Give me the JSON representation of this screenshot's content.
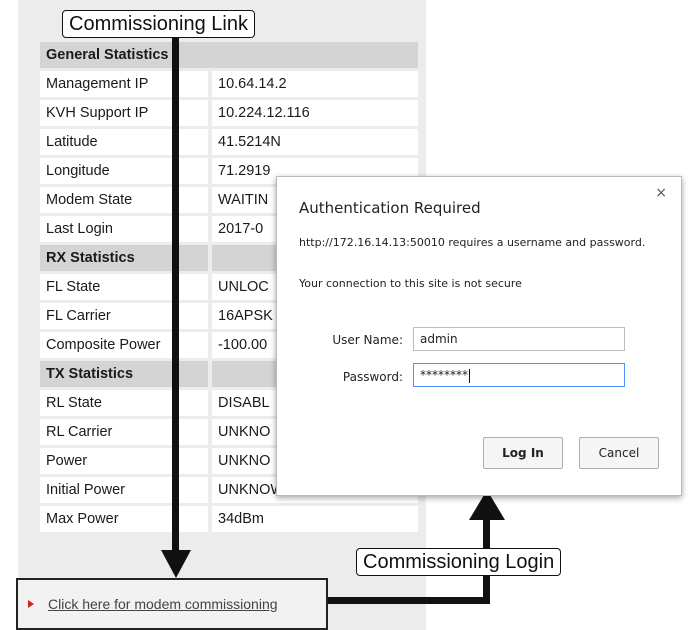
{
  "callouts": {
    "top": "Commissioning Link",
    "bottom": "Commissioning Login"
  },
  "stats": {
    "rows": [
      {
        "key": "General Statistics",
        "value": "",
        "type": "head"
      },
      {
        "key": "Management IP",
        "value": "10.64.14.2"
      },
      {
        "key": "KVH Support IP",
        "value": "10.224.12.116"
      },
      {
        "key": "Latitude",
        "value": "41.5214N"
      },
      {
        "key": "Longitude",
        "value": "71.2919"
      },
      {
        "key": "Modem State",
        "value": "WAITIN"
      },
      {
        "key": "Last Login",
        "value": "2017-0"
      },
      {
        "key": "RX Statistics",
        "value": "",
        "type": "head2"
      },
      {
        "key": "FL State",
        "value": "UNLOC"
      },
      {
        "key": "FL Carrier",
        "value": "16APSK"
      },
      {
        "key": "Composite Power",
        "value": "-100.00"
      },
      {
        "key": "TX Statistics",
        "value": "",
        "type": "head2"
      },
      {
        "key": "RL State",
        "value": "DISABL"
      },
      {
        "key": "RL Carrier",
        "value": "UNKNO"
      },
      {
        "key": "Power",
        "value": "UNKNO"
      },
      {
        "key": "Initial Power",
        "value": "UNKNOWN"
      },
      {
        "key": "Max Power",
        "value": "34dBm"
      }
    ]
  },
  "link": {
    "text": "Click here for modem commissioning",
    "arrow_color": "#c8281e"
  },
  "dialog": {
    "title": "Authentication Required",
    "close_glyph": "×",
    "message": "http://172.16.14.13:50010 requires a username and password.",
    "security_note": "Your connection to this site is not secure",
    "username_label": "User Name:",
    "username_value": "admin",
    "password_label": "Password:",
    "password_value": "********",
    "login_label": "Log In",
    "cancel_label": "Cancel"
  }
}
